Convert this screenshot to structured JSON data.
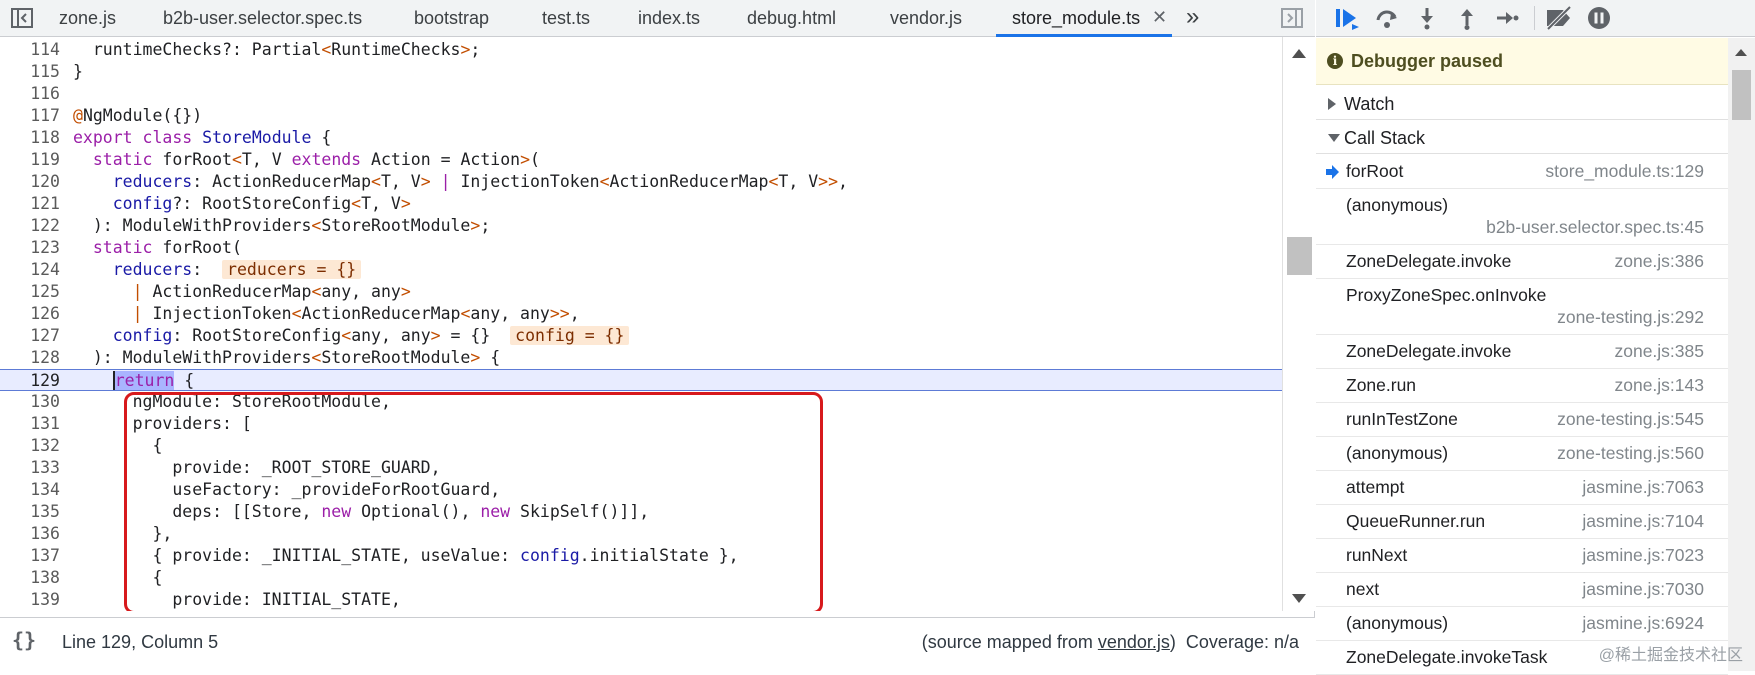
{
  "editor_tabs": {
    "items": [
      {
        "label": "zone.js"
      },
      {
        "label": "b2b-user.selector.spec.ts"
      },
      {
        "label": "bootstrap"
      },
      {
        "label": "test.ts"
      },
      {
        "label": "index.ts"
      },
      {
        "label": "debug.html"
      },
      {
        "label": "vendor.js"
      },
      {
        "label": "store_module.ts",
        "active": true
      }
    ],
    "close_glyph": "✕",
    "more_glyph": "»"
  },
  "code": {
    "lines": [
      {
        "n": "114"
      },
      {
        "n": "115"
      },
      {
        "n": "116"
      },
      {
        "n": "117"
      },
      {
        "n": "118"
      },
      {
        "n": "119"
      },
      {
        "n": "120"
      },
      {
        "n": "121"
      },
      {
        "n": "122"
      },
      {
        "n": "123"
      },
      {
        "n": "124"
      },
      {
        "n": "125"
      },
      {
        "n": "126"
      },
      {
        "n": "127"
      },
      {
        "n": "128"
      },
      {
        "n": "129"
      },
      {
        "n": "130"
      },
      {
        "n": "131"
      },
      {
        "n": "132"
      },
      {
        "n": "133"
      },
      {
        "n": "134"
      },
      {
        "n": "135"
      },
      {
        "n": "136"
      },
      {
        "n": "137"
      },
      {
        "n": "138"
      },
      {
        "n": "139"
      }
    ],
    "current_line": "129"
  },
  "status_bar": {
    "braces": "{}",
    "position": "Line 129, Column 5",
    "source_mapped_prefix": "(source mapped from ",
    "source_mapped_link": "vendor.js",
    "source_mapped_suffix": ")",
    "coverage": "Coverage: n/a"
  },
  "debugger": {
    "toolbar_icons": [
      "resume-icon",
      "step-over-icon",
      "step-into-icon",
      "step-out-icon",
      "step-icon",
      "deactivate-breakpoints-icon",
      "pause-on-exceptions-icon"
    ],
    "paused_text": "Debugger paused",
    "watch_label": "Watch",
    "callstack_label": "Call Stack",
    "frames": [
      {
        "name": "forRoot",
        "loc": "store_module.ts:129",
        "current": true
      },
      {
        "name": "(anonymous)",
        "loc": "b2b-user.selector.spec.ts:45",
        "wrap": true
      },
      {
        "name": "ZoneDelegate.invoke",
        "loc": "zone.js:386"
      },
      {
        "name": "ProxyZoneSpec.onInvoke",
        "loc": "zone-testing.js:292",
        "wrap": true
      },
      {
        "name": "ZoneDelegate.invoke",
        "loc": "zone.js:385"
      },
      {
        "name": "Zone.run",
        "loc": "zone.js:143"
      },
      {
        "name": "runInTestZone",
        "loc": "zone-testing.js:545"
      },
      {
        "name": "(anonymous)",
        "loc": "zone-testing.js:560"
      },
      {
        "name": "attempt",
        "loc": "jasmine.js:7063"
      },
      {
        "name": "QueueRunner.run",
        "loc": "jasmine.js:7104"
      },
      {
        "name": "runNext",
        "loc": "jasmine.js:7023"
      },
      {
        "name": "next",
        "loc": "jasmine.js:7030"
      },
      {
        "name": "(anonymous)",
        "loc": "jasmine.js:6924"
      },
      {
        "name": "ZoneDelegate.invokeTask",
        "loc": ""
      }
    ]
  },
  "watermark": "@稀土掘金技术社区",
  "colors": {
    "accent": "#1a73e8",
    "highlight_box": "#d7191c",
    "paused_bg": "#fffbe4"
  }
}
